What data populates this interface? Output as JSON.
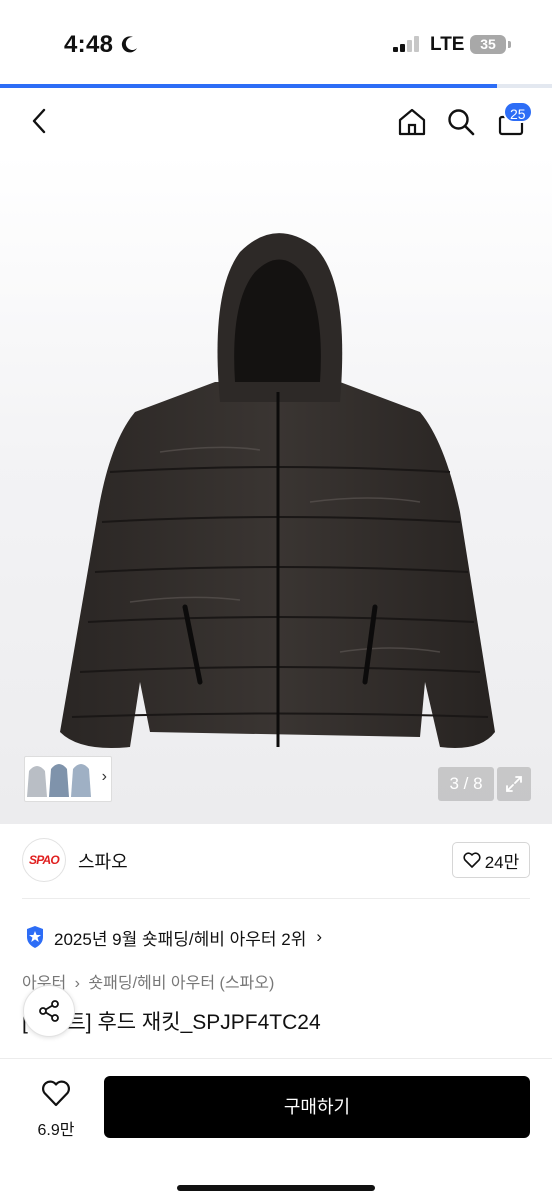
{
  "status_bar": {
    "time": "4:48",
    "network": "LTE",
    "battery": "35"
  },
  "page_load_progress": 0.9,
  "nav": {
    "cart_count": "25"
  },
  "gallery": {
    "counter": "3 / 8",
    "thumbnail_arrow": "›"
  },
  "brand": {
    "logo_text": "SPAO",
    "name": "스파오",
    "like_count": "24만"
  },
  "ranking": {
    "text": "2025년 9월 숏패딩/헤비 아우터 2위",
    "arrow": "›"
  },
  "breadcrumb": {
    "level1": "아우터",
    "separator": "›",
    "level2": "숏패딩/헤비 아우터 (스파오)"
  },
  "product": {
    "title": "[라이트] 후드 재킷_SPJPF4TC24"
  },
  "bottom_bar": {
    "like_count": "6.9만",
    "buy_label": "구매하기"
  },
  "colors": {
    "accent": "#2d6df6",
    "buy_button": "#000000",
    "brand_logo": "#e02020"
  }
}
